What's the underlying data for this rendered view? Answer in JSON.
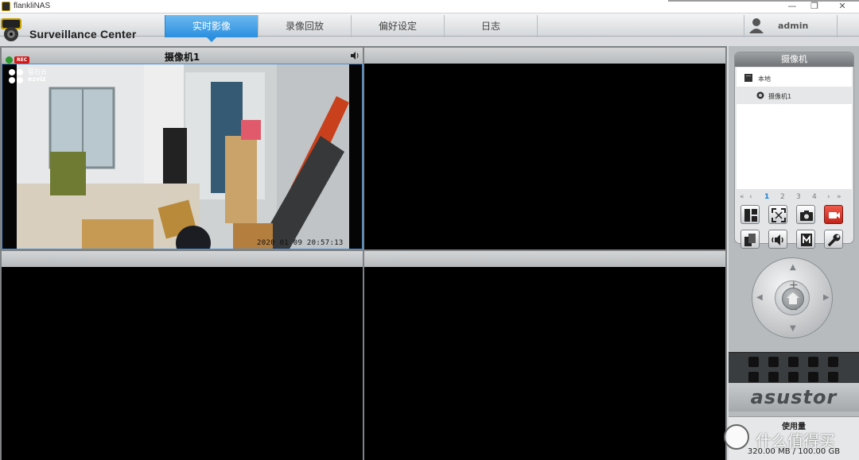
{
  "window": {
    "title": "flankliNAS",
    "min_glyph": "—",
    "restore_glyph": "❐",
    "close_glyph": "✕"
  },
  "header": {
    "brand": "Surveillance Center",
    "tabs": [
      {
        "label": "实时影像",
        "active": true
      },
      {
        "label": "录像回放",
        "active": false
      },
      {
        "label": "偏好设定",
        "active": false
      },
      {
        "label": "日志",
        "active": false
      }
    ],
    "user": "admin"
  },
  "main": {
    "cells": [
      {
        "title": "摄像机1",
        "rec_badge": "REC",
        "has_video": true,
        "timestamp": "2020 01 09 20:57:13",
        "logo_cn": "萤石云",
        "logo_en": "ezviz"
      },
      {
        "title": "",
        "has_video": false
      },
      {
        "title": "",
        "has_video": false
      },
      {
        "title": "",
        "has_video": false
      }
    ]
  },
  "sidebar": {
    "panel_title": "摄像机",
    "tree": [
      {
        "label": "本地",
        "icon": "server-icon",
        "selected": false
      },
      {
        "label": "摄像机1",
        "icon": "camera-icon",
        "selected": true
      }
    ],
    "pager": {
      "first": "«",
      "prev": "‹",
      "pages": [
        "1",
        "2",
        "3",
        "4"
      ],
      "current": "1",
      "next": "›",
      "last": "»"
    },
    "tools": [
      {
        "name": "layout-icon"
      },
      {
        "name": "fullscreen-icon"
      },
      {
        "name": "snapshot-icon"
      },
      {
        "name": "record-icon"
      },
      {
        "name": "copy-icon"
      },
      {
        "name": "audio-icon"
      },
      {
        "name": "manual-icon"
      },
      {
        "name": "settings-wrench-icon"
      }
    ],
    "dpad": {
      "zoom_in": "+",
      "zoom_out": "−"
    },
    "brand": "asustor",
    "usage_label": "使用量",
    "usage_value": "320.00 MB / 100.00 GB"
  },
  "watermark": {
    "text": "什么值得买"
  },
  "colors": {
    "accent": "#2a8fdf",
    "rec": "#d01818",
    "live": "#2a9a2a"
  }
}
